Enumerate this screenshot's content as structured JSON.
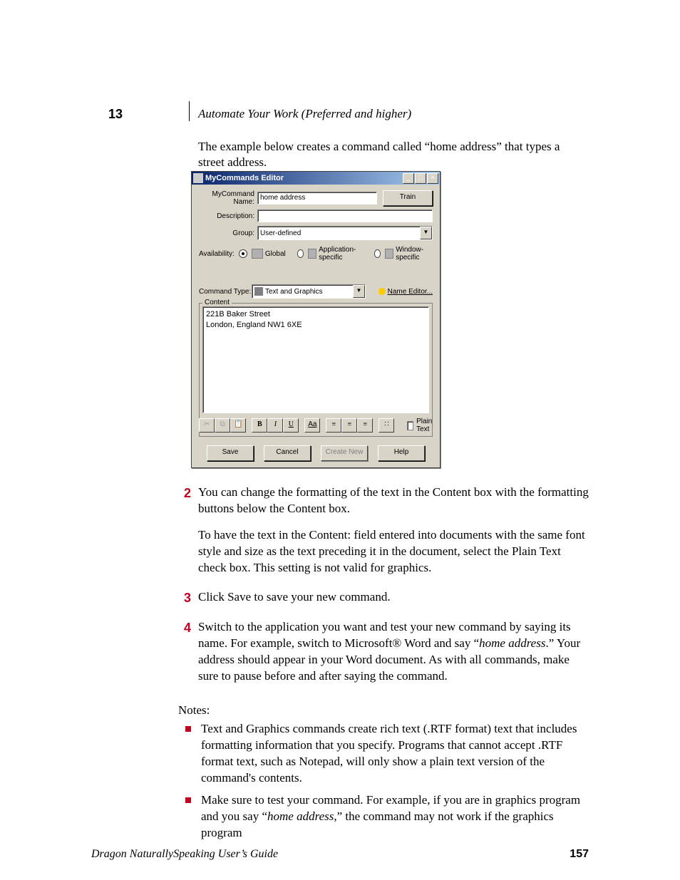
{
  "header": {
    "chapter_number": "13",
    "chapter_title": "Automate Your Work (Preferred and higher)"
  },
  "intro": "The example below creates a command called “home address” that types a street address.",
  "dialog": {
    "title": "MyCommands Editor",
    "labels": {
      "name": "MyCommand Name:",
      "description": "Description:",
      "group": "Group:",
      "availability": "Availability:",
      "command_type": "Command Type:",
      "content_legend": "Content"
    },
    "values": {
      "name": "home address",
      "description": "",
      "group": "User-defined",
      "command_type": "Text and Graphics",
      "content": "221B Baker Street\nLondon, England NW1 6XE"
    },
    "availability_options": {
      "global": "Global",
      "app": "Application-specific",
      "window": "Window-specific"
    },
    "buttons": {
      "train": "Train",
      "name_editor": "Name Editor...",
      "save": "Save",
      "cancel": "Cancel",
      "create_new": "Create New",
      "help": "Help"
    },
    "toolbar": {
      "bold": "B",
      "italic": "I",
      "underline": "U",
      "font": "Aa",
      "plain_text": "Plain Text"
    }
  },
  "steps": {
    "s2": {
      "num": "2",
      "p1": "You can change the formatting of the text in the Content box with the formatting buttons below the Content box.",
      "p2": "To have the text in the Content: field entered into documents with the same font style and size as the text preceding it in the document, select the Plain Text check box. This setting is not valid for graphics."
    },
    "s3": {
      "num": "3",
      "p1": "Click Save to save your new command."
    },
    "s4": {
      "num": "4",
      "p1_a": "Switch to the application you want and test your new command by saying its name. For example, switch to Microsoft® Word and say “",
      "p1_em": "home address",
      "p1_b": ".” Your address should appear in your Word document. As with all commands, make sure to pause before and after saying the command."
    }
  },
  "notes": {
    "heading": "Notes:",
    "b1": "Text and Graphics commands create rich text (.RTF format) text that includes formatting information that you specify. Programs that cannot accept .RTF format text, such as Notepad, will only show a plain text version of the command's contents.",
    "b2_a": "Make sure to test your command. For example, if you are in graphics program and you say “",
    "b2_em": "home address",
    "b2_b": ",” the command may not work if the graphics program"
  },
  "footer": {
    "left": "Dragon NaturallySpeaking User’s Guide",
    "page": "157"
  }
}
